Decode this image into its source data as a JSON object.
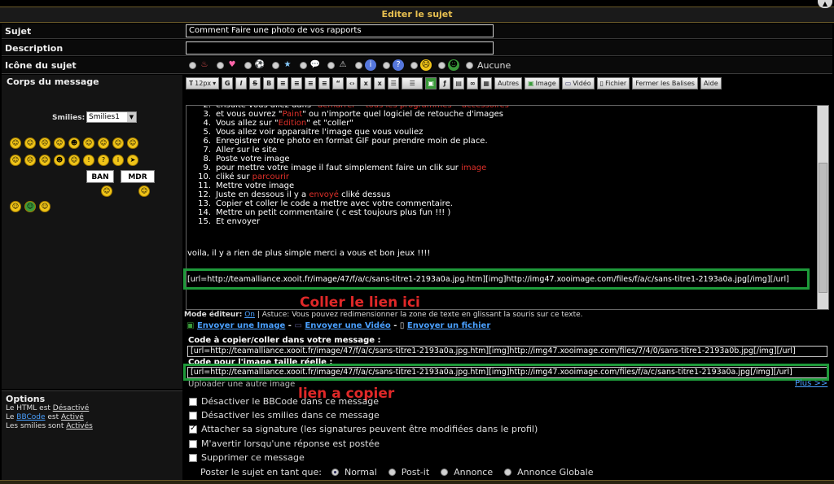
{
  "header": {
    "title": "Editer le sujet"
  },
  "labels": {
    "subject": "Sujet",
    "description": "Description",
    "topic_icon": "Icône du sujet",
    "message_body": "Corps du message",
    "options": "Options"
  },
  "subject_value": "Comment Faire une photo de vos rapports",
  "description_value": "",
  "icons": {
    "none_label": "Aucune",
    "items": [
      "fire-icon",
      "heart-icon",
      "football-icon",
      "star-icon",
      "speech-icon",
      "warning-icon",
      "info-icon",
      "question-icon",
      "sad-icon",
      "frog-icon"
    ]
  },
  "smilies": {
    "label": "Smilies:",
    "select_value": "Smilies1",
    "ban": "BAN",
    "mdr": "MDR"
  },
  "toolbar": {
    "font_size": "12px",
    "buttons": [
      "G",
      "I",
      "S",
      "B"
    ],
    "autres": "Autres",
    "image": "Image",
    "video": "Vidéo",
    "fichier": "Fichier",
    "fermer": "Fermer les Balises",
    "aide": "Aide"
  },
  "editor": {
    "lines": [
      {
        "n": "2.",
        "parts": [
          {
            "t": "ensuite vous allez dans "
          },
          {
            "t": "\"démarrer\" \"tous les programmes\" \"accessoires\"",
            "c": "red"
          }
        ]
      },
      {
        "n": "3.",
        "parts": [
          {
            "t": "et vous ouvrez \""
          },
          {
            "t": "Paint",
            "c": "red"
          },
          {
            "t": "\" ou n'importe quel logiciel de retouche d'images"
          }
        ]
      },
      {
        "n": "4.",
        "parts": [
          {
            "t": "Vous allez sur \""
          },
          {
            "t": "Edition",
            "c": "red"
          },
          {
            "t": "\" et \"coller\""
          }
        ]
      },
      {
        "n": "5.",
        "parts": [
          {
            "t": "Vous allez voir apparaitre l'image que vous vouliez"
          }
        ]
      },
      {
        "n": "6.",
        "parts": [
          {
            "t": "Enregistrer votre photo en  format GIF pour prendre moin  de place."
          }
        ]
      },
      {
        "n": "7.",
        "parts": [
          {
            "t": "Aller sur le site"
          }
        ]
      },
      {
        "n": "8.",
        "parts": [
          {
            "t": "Poste votre image"
          }
        ]
      },
      {
        "n": "9.",
        "parts": [
          {
            "t": "pour mettre votre image il  faut simplement faire un  clik  sur "
          },
          {
            "t": "image",
            "c": "red"
          }
        ]
      },
      {
        "n": "10.",
        "parts": [
          {
            "t": "cliké sur "
          },
          {
            "t": "parcourir",
            "c": "red"
          }
        ]
      },
      {
        "n": "11.",
        "parts": [
          {
            "t": "Mettre votre image"
          }
        ]
      },
      {
        "n": "12.",
        "parts": [
          {
            "t": "Juste en dessous il y a "
          },
          {
            "t": "envoyé",
            "c": "red"
          },
          {
            "t": "  cliké dessus"
          }
        ]
      },
      {
        "n": "13.",
        "parts": [
          {
            "t": "Copier et coller le code a mettre avec votre commentaire."
          }
        ]
      },
      {
        "n": "14.",
        "parts": [
          {
            "t": "Mettre un petit commentaire ( c est  toujours plus fun !!! )"
          }
        ]
      },
      {
        "n": "15.",
        "parts": [
          {
            "t": "Et envoyer"
          }
        ]
      }
    ],
    "closing": "voila, il y  a rien  de plus simple merci  a vous et bon  jeux !!!!",
    "code_line": "[url=http://teamalliance.xooit.fr/image/47/f/a/c/sans-titre1-2193a0a.jpg.htm][img]http://img47.xooimage.com/files/f/a/c/sans-titre1-2193a0a.jpg[/img][/url]"
  },
  "annotations": {
    "paste_here": "Coller le lien  ici",
    "link_to_copy": "lien  a copier"
  },
  "mode_editeur": {
    "prefix": "Mode éditeur:",
    "state": "On",
    "astuce": " | Astuce: Vous pouvez redimensionner la zone de texte en glissant la souris sur ce texte."
  },
  "upload_links": {
    "image": "Envoyer une Image",
    "video": "Envoyer une Vidéo",
    "file": "Envoyer un fichier",
    "sep": " - "
  },
  "code_copy": {
    "label": "Code à copier/coller dans votre message :",
    "value": "[url=http://teamalliance.xooit.fr/image/47/f/a/c/sans-titre1-2193a0a.jpg.htm][img]http://img47.xooimage.com/files/7/4/0/sans-titre1-2193a0b.jpg[/img][/url]",
    "label2": "Code pour l'image taille réelle :",
    "value2": "[url=http://teamalliance.xooit.fr/image/47/f/a/c/sans-titre1-2193a0a.jpg.htm][img]http://img47.xooimage.com/files/f/a/c/sans-titre1-2193a0a.jpg[/img][/url]",
    "upload_other": "Uploader une autre image",
    "plus": "Plus >>"
  },
  "options_info": {
    "html_prefix": "Le HTML est ",
    "html_state": "Désactivé",
    "bb_prefix": "Le ",
    "bb_link": "BBCode",
    "bb_mid": " est ",
    "bb_state": "Activé",
    "smilies_prefix": "Les smilies sont ",
    "smilies_state": "Activés"
  },
  "checkboxes": [
    {
      "label": "Désactiver le BBCode dans ce message",
      "checked": false
    },
    {
      "label": "Désactiver les smilies dans ce message",
      "checked": false
    },
    {
      "label": "Attacher sa signature (les signatures peuvent être modifiées dans le profil)",
      "checked": true
    },
    {
      "label": "M'avertir lorsqu'une réponse est postée",
      "checked": false
    },
    {
      "label": "Supprimer ce message",
      "checked": false
    }
  ],
  "post_as": {
    "label": "Poster le sujet en tant que:",
    "options": [
      "Normal",
      "Post-it",
      "Annonce",
      "Annonce Globale"
    ],
    "selected": "Normal"
  }
}
